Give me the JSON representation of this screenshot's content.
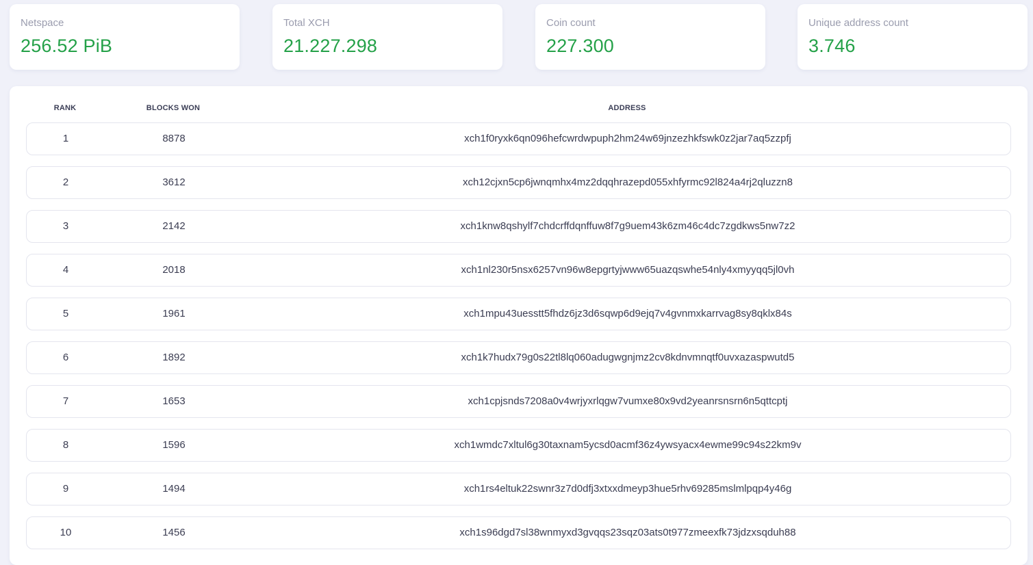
{
  "stats": [
    {
      "label": "Netspace",
      "value": "256.52 PiB"
    },
    {
      "label": "Total XCH",
      "value": "21.227.298"
    },
    {
      "label": "Coin count",
      "value": "227.300"
    },
    {
      "label": "Unique address count",
      "value": "3.746"
    }
  ],
  "colors": {
    "accent_green": "#24a148",
    "page_background": "#f0f1f9",
    "label_gray": "#9a9cae"
  },
  "table": {
    "headers": {
      "rank": "RANK",
      "blocks_won": "BLOCKS WON",
      "address": "ADDRESS"
    },
    "rows": [
      {
        "rank": "1",
        "blocks_won": "8878",
        "address": "xch1f0ryxk6qn096hefcwrdwpuph2hm24w69jnzezhkfswk0z2jar7aq5zzpfj"
      },
      {
        "rank": "2",
        "blocks_won": "3612",
        "address": "xch12cjxn5cp6jwnqmhx4mz2dqqhrazepd055xhfyrmc92l824a4rj2qluzzn8"
      },
      {
        "rank": "3",
        "blocks_won": "2142",
        "address": "xch1knw8qshylf7chdcrffdqnffuw8f7g9uem43k6zm46c4dc7zgdkws5nw7z2"
      },
      {
        "rank": "4",
        "blocks_won": "2018",
        "address": "xch1nl230r5nsx6257vn96w8epgrtyjwww65uazqswhe54nly4xmyyqq5jl0vh"
      },
      {
        "rank": "5",
        "blocks_won": "1961",
        "address": "xch1mpu43uesstt5fhdz6jz3d6sqwp6d9ejq7v4gvnmxkarrvag8sy8qklx84s"
      },
      {
        "rank": "6",
        "blocks_won": "1892",
        "address": "xch1k7hudx79g0s22tl8lq060adugwgnjmz2cv8kdnvmnqtf0uvxazaspwutd5"
      },
      {
        "rank": "7",
        "blocks_won": "1653",
        "address": "xch1cpjsnds7208a0v4wrjyxrlqgw7vumxe80x9vd2yeanrsnsrn6n5qttcptj"
      },
      {
        "rank": "8",
        "blocks_won": "1596",
        "address": "xch1wmdc7xltul6g30taxnam5ycsd0acmf36z4ywsyacx4ewme99c94s22km9v"
      },
      {
        "rank": "9",
        "blocks_won": "1494",
        "address": "xch1rs4eltuk22swnr3z7d0dfj3xtxxdmeyp3hue5rhv69285mslmlpqp4y46g"
      },
      {
        "rank": "10",
        "blocks_won": "1456",
        "address": "xch1s96dgd7sl38wnmyxd3gvqqs23sqz03ats0t977zmeexfk73jdzxsqduh88"
      }
    ]
  }
}
